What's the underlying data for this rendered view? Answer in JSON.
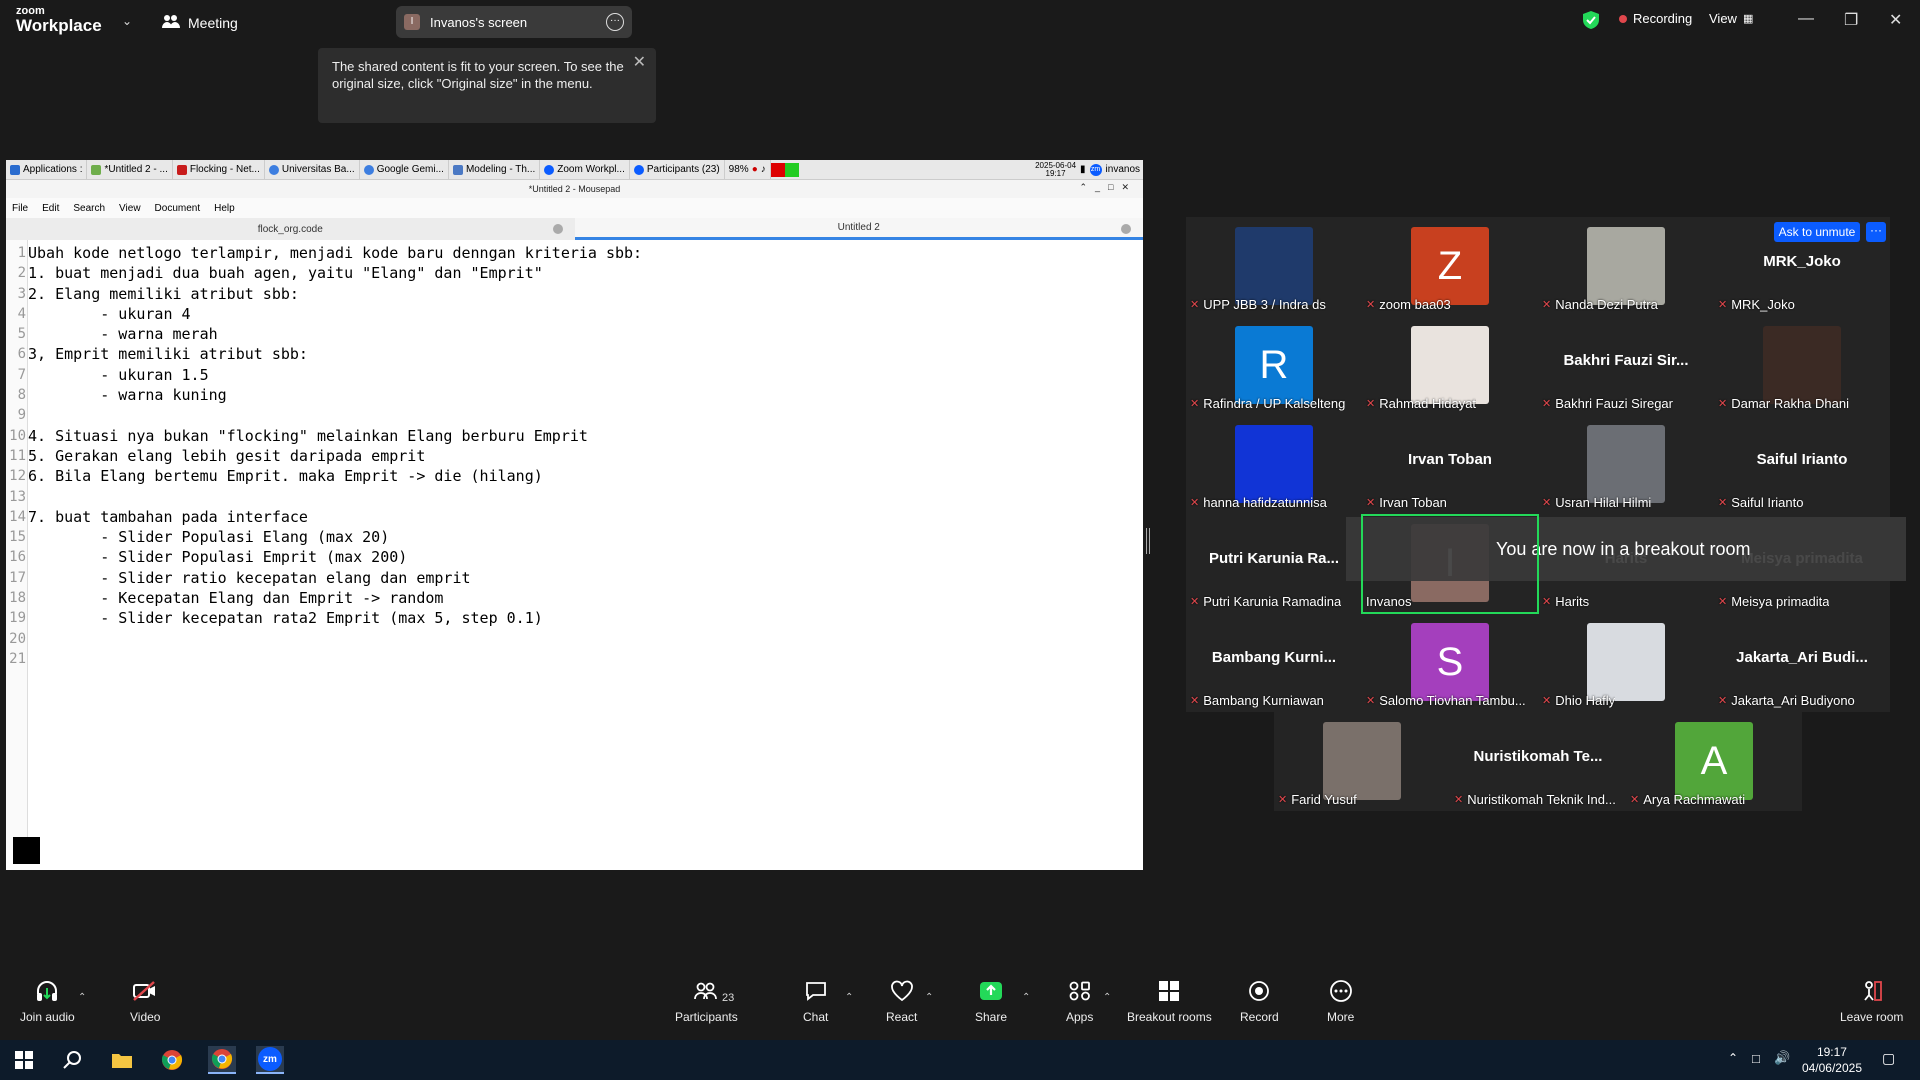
{
  "app": {
    "logo_small": "zoom",
    "logo_big": "Workplace",
    "meeting_label": "Meeting",
    "screen_initial": "I",
    "screen_title": "Invanos's screen",
    "recording_label": "Recording",
    "view_label": "View",
    "colors": {
      "accent": "#0b5cff",
      "recording": "#e0474c",
      "speaker_border": "#23d959",
      "shield": "#23d959"
    }
  },
  "tooltip": {
    "text": "The shared content is fit to your screen. To see the original size, click \"Original size\" in the menu."
  },
  "shared": {
    "tasks": [
      "Applications :",
      "*Untitled 2 - ...",
      "Flocking - Net...",
      "Universitas Ba...",
      "Google Gemi...",
      "Modeling - Th...",
      "Zoom Workpl...",
      "Participants (23)"
    ],
    "battery": "98%",
    "sys_date": "2025-06-04",
    "sys_time": "19:17",
    "user": "invanos",
    "window_title": "*Untitled 2 - Mousepad",
    "menu": [
      "File",
      "Edit",
      "Search",
      "View",
      "Document",
      "Help"
    ],
    "tabs": [
      "flock_org.code",
      "Untitled 2"
    ],
    "lines": [
      "Ubah kode netlogo terlampir, menjadi kode baru denngan kriteria sbb:",
      "1. buat menjadi dua buah agen, yaitu \"Elang\" dan \"Emprit\"",
      "2. Elang memiliki atribut sbb:",
      "        - ukuran 4",
      "        - warna merah",
      "3, Emprit memiliki atribut sbb:",
      "        - ukuran 1.5",
      "        - warna kuning",
      "",
      "4. Situasi nya bukan \"flocking\" melainkan Elang berburu Emprit",
      "5. Gerakan elang lebih gesit daripada emprit",
      "6. Bila Elang bertemu Emprit. maka Emprit -> die (hilang)",
      "",
      "7. buat tambahan pada interface",
      "        - Slider Populasi Elang (max 20)",
      "        - Slider Populasi Emprit (max 200)",
      "        - Slider ratio kecepatan elang dan emprit",
      "        - Kecepatan Elang dan Emprit -> random",
      "        - Slider kecepatan rata2 Emprit (max 5, step 0.1)",
      "",
      ""
    ]
  },
  "gallery": {
    "ask_to_unmute": "Ask to unmute",
    "more": "···",
    "breakout_message": "You are now in a breakout room",
    "tiles": [
      {
        "name": "UPP JBB 3 / Indra ds",
        "type": "photo",
        "color": "#1f3a6b"
      },
      {
        "name": "zoom baa03",
        "type": "letter",
        "letter": "Z",
        "color": "#c8401f"
      },
      {
        "name": "Nanda Dezi Putra",
        "type": "photo",
        "color": "#a8a8a0"
      },
      {
        "name": "MRK_Joko",
        "type": "text",
        "display": "MRK_Joko"
      },
      {
        "name": "Rafindra / UP Kalselteng",
        "type": "letter",
        "letter": "R",
        "color": "#0a7ad4"
      },
      {
        "name": "Rahmad Hidayat",
        "type": "photo",
        "color": "#e9e3de"
      },
      {
        "name": "Bakhri Fauzi Siregar",
        "type": "text",
        "display": "Bakhri Fauzi Sir..."
      },
      {
        "name": "Damar Rakha Dhani",
        "type": "photo",
        "color": "#3b2a24"
      },
      {
        "name": "hanna hafidzatunnisa",
        "type": "photo",
        "color": "#1134d6"
      },
      {
        "name": "Irvan Toban",
        "type": "text",
        "display": "Irvan Toban"
      },
      {
        "name": "Usran Hilal Hilmi",
        "type": "photo",
        "color": "#6b6e74"
      },
      {
        "name": "Saiful Irianto",
        "type": "text",
        "display": "Saiful Irianto"
      },
      {
        "name": "Putri Karunia Ramadina",
        "type": "text",
        "display": "Putri Karunia Ra..."
      },
      {
        "name": "Invanos",
        "type": "letter",
        "letter": "I",
        "color": "#8a6a62"
      },
      {
        "name": "Harits",
        "type": "text",
        "display": "Harits"
      },
      {
        "name": "Meisya primadita",
        "type": "text",
        "display": "Meisya primadita"
      },
      {
        "name": "Bambang Kurniawan",
        "type": "text",
        "display": "Bambang Kurni..."
      },
      {
        "name": "Salomo Tiovhan Tambu...",
        "type": "letter",
        "letter": "S",
        "color": "#a43fbd"
      },
      {
        "name": "Dhio Hafly",
        "type": "photo",
        "color": "#d8dbe0"
      },
      {
        "name": "Jakarta_Ari Budiyono",
        "type": "text",
        "display": "Jakarta_Ari Budi..."
      },
      {
        "name": "Farid Yusuf",
        "type": "photo",
        "color": "#7a706a"
      },
      {
        "name": "Nuristikomah Teknik Ind...",
        "type": "text",
        "display": "Nuristikomah Te..."
      },
      {
        "name": "Arya Rachmawati",
        "type": "letter",
        "letter": "A",
        "color": "#52a63a"
      }
    ]
  },
  "toolbar": {
    "join_audio": "Join audio",
    "video": "Video",
    "participants": "Participants",
    "participants_count": "23",
    "chat": "Chat",
    "react": "React",
    "share": "Share",
    "apps": "Apps",
    "breakout_rooms": "Breakout rooms",
    "record": "Record",
    "more": "More",
    "leave_room": "Leave room"
  },
  "taskbar": {
    "time": "19:17",
    "date": "04/06/2025"
  }
}
